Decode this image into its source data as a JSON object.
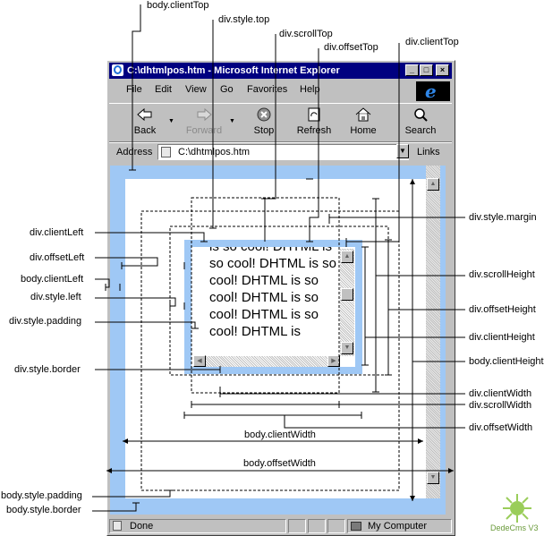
{
  "window": {
    "title": "C:\\dhtmlpos.htm - Microsoft Internet Explorer",
    "min_icon": "_",
    "max_icon": "□",
    "close_icon": "×"
  },
  "menu": [
    "File",
    "Edit",
    "View",
    "Go",
    "Favorites",
    "Help"
  ],
  "toolbar": [
    {
      "label": "Back",
      "icon": "back-arrow-icon",
      "enabled": true
    },
    {
      "label": "Forward",
      "icon": "forward-arrow-icon",
      "enabled": false
    },
    {
      "label": "Stop",
      "icon": "stop-icon",
      "enabled": true
    },
    {
      "label": "Refresh",
      "icon": "refresh-icon",
      "enabled": true
    },
    {
      "label": "Home",
      "icon": "home-icon",
      "enabled": true
    },
    {
      "label": "Search",
      "icon": "search-icon",
      "enabled": true
    }
  ],
  "address": {
    "label": "Address",
    "value": "C:\\dhtmlpos.htm",
    "links_label": "Links"
  },
  "div_text": "is so cool! DHTML is so cool! DHTML is so cool! DHTML is so cool! DHTML is so cool! DHTML is so cool! DHTML is",
  "status": {
    "text": "Done",
    "zone": "My Computer"
  },
  "annotations": {
    "body_clientTop": "body.clientTop",
    "div_style_top": "div.style.top",
    "div_scrollTop": "div.scrollTop",
    "div_offsetTop": "div.offsetTop",
    "div_clientTop": "div.clientTop",
    "div_style_margin": "div.style.margin",
    "div_clientLeft": "div.clientLeft",
    "div_offsetLeft": "div.offsetLeft",
    "body_clientLeft": "body.clientLeft",
    "div_style_left": "div.style.left",
    "div_style_padding": "div.style.padding",
    "div_style_border": "div.style.border",
    "div_scrollHeight": "div.scrollHeight",
    "div_offsetHeight": "div.offsetHeight",
    "div_clientHeight": "div.clientHeight",
    "body_clientHeight": "body.clientHeight",
    "div_clientWidth": "div.clientWidth",
    "div_scrollWidth": "div.scrollWidth",
    "div_offsetWidth": "div.offsetWidth",
    "body_clientWidth": "body.clientWidth",
    "body_offsetWidth": "body.offsetWidth",
    "body_style_padding": "body.style.padding",
    "body_style_border": "body.style.border"
  },
  "watermark": "DedeCms V3"
}
